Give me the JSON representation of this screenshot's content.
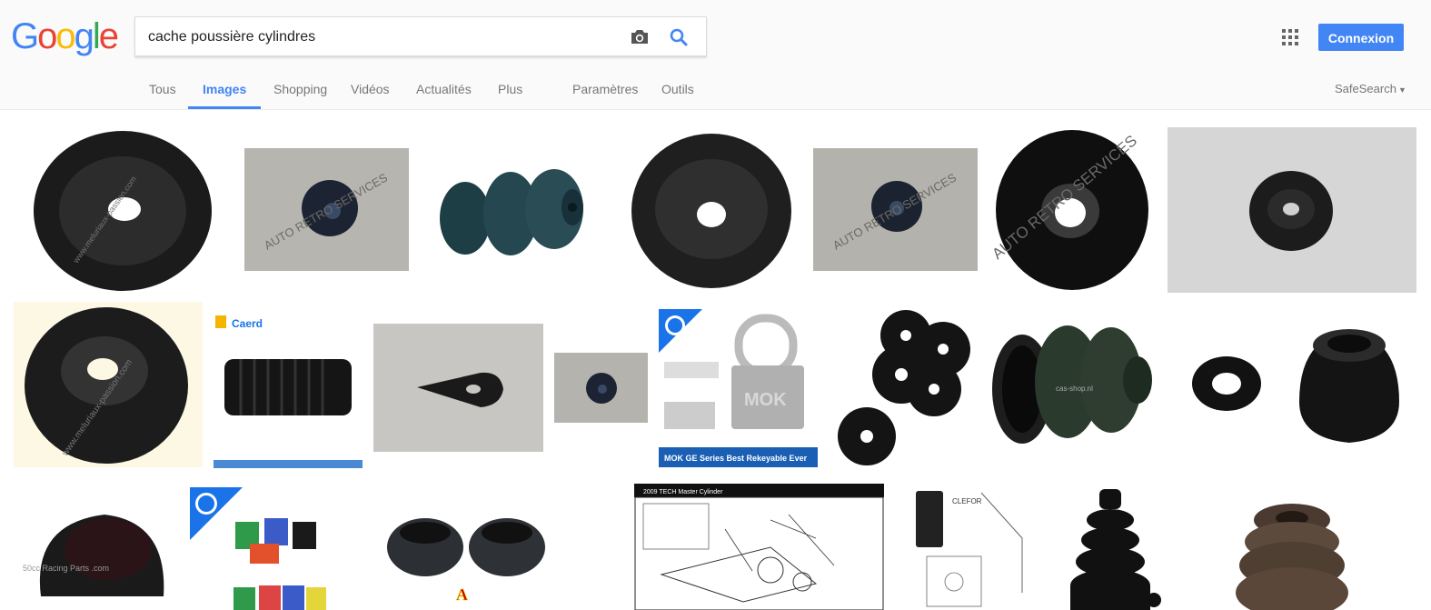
{
  "logo": {
    "letters": [
      "G",
      "o",
      "o",
      "g",
      "l",
      "e"
    ],
    "colors": [
      "#4285f4",
      "#ea4335",
      "#fbbc05",
      "#4285f4",
      "#34a853",
      "#ea4335"
    ]
  },
  "search": {
    "value": "cache poussière cylindres"
  },
  "header": {
    "signin_label": "Connexion",
    "safesearch_label": "SafeSearch"
  },
  "tabs": [
    {
      "label": "Tous"
    },
    {
      "label": "Images",
      "active": true
    },
    {
      "label": "Shopping"
    },
    {
      "label": "Vidéos"
    },
    {
      "label": "Actualités"
    },
    {
      "label": "Plus"
    },
    {
      "label": "Paramètres"
    },
    {
      "label": "Outils"
    }
  ],
  "thumbs": {
    "watermark_meluriaux": "www.meluriaux-passion.com",
    "watermark_auto": "AUTO RETRO SERVICES",
    "caerd_brand": "Caerd",
    "lock_banner": "MOK  GE Series Best Rekeyable Ever",
    "lock_brand": "MOK",
    "cas_shop": "cas-shop.nl",
    "diagram_title": "2009 TECH Master Cylinder",
    "cleror": "CLEFOR",
    "racing": "50cc Racing Parts .com",
    "letter_a": "A"
  },
  "colors": {
    "accent": "#4285f4",
    "rubber": "#1b1b1b"
  }
}
